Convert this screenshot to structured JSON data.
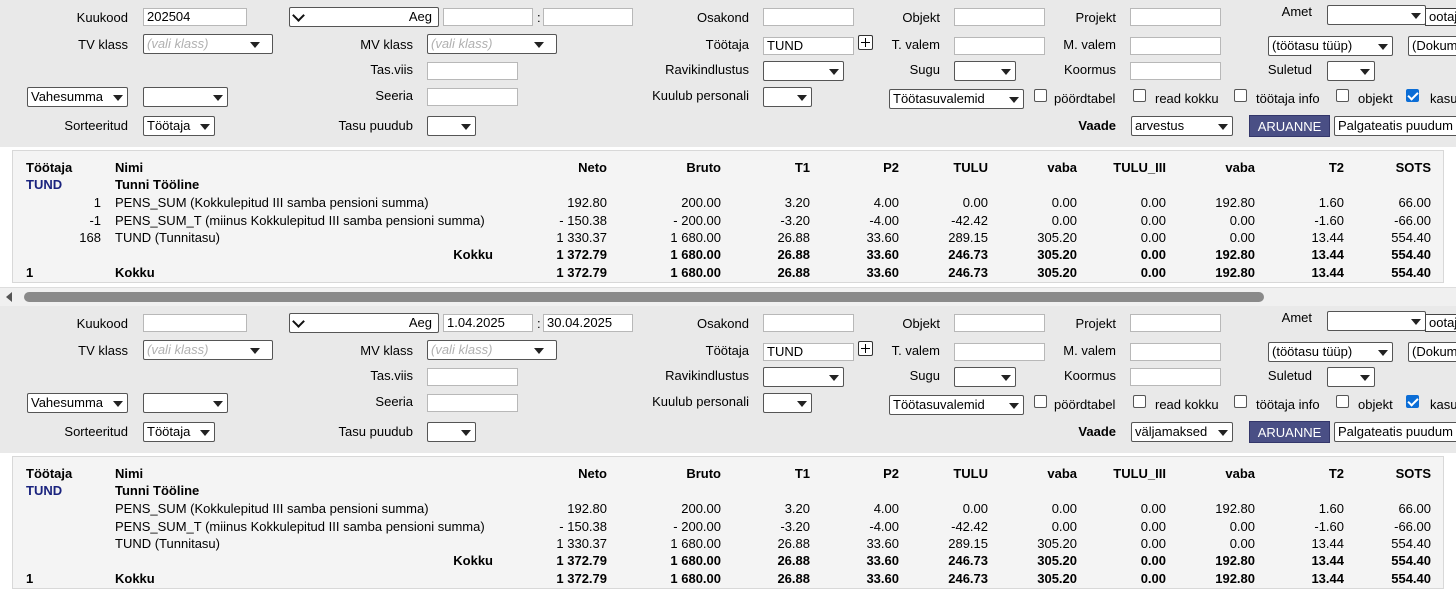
{
  "panels": [
    {
      "kuukood_label": "Kuukood",
      "kuukood_value": "202504",
      "aeg_select": "",
      "aeg_label": "Aeg",
      "aeg_from": "",
      "aeg_sep": ":",
      "aeg_to": "",
      "osakond_label": "Osakond",
      "objekt_label": "Objekt",
      "projekt_label": "Projekt",
      "amet_label": "Amet",
      "amet_select": "",
      "ootaja_value": "ootaja",
      "tvklass_label": "TV klass",
      "tvklass_ph": "(vali klass)",
      "mvklass_label": "MV klass",
      "mvklass_ph": "(vali klass)",
      "tootaja_label": "Töötaja",
      "tootaja_value": "TUND",
      "tvalem_label": "T. valem",
      "mvalem_label": "M. valem",
      "tootasu_tyyp": "(töötasu tüüp)",
      "dokum": "(Dokum",
      "tasviis_label": "Tas.viis",
      "ravikindlustus_label": "Ravikindlustus",
      "sugu_label": "Sugu",
      "koormus_label": "Koormus",
      "suletud_label": "Suletud",
      "vahesumma": "Vahesumma",
      "seeria_label": "Seeria",
      "kuulub_label": "Kuulub personali",
      "tootasuvalemid": "Töötasuvalemid",
      "poordtabel": "pöördtabel",
      "read_kokku": "read kokku",
      "tootaja_info": "töötaja info",
      "objekt_chk": "objekt",
      "kasu_chk": "kasu",
      "sorteeritud_label": "Sorteeritud",
      "sorteeritud_value": "Töötaja",
      "tasu_puudub_label": "Tasu puudub",
      "vaade_label": "Vaade",
      "vaade_value": "arvestus",
      "aruanne": "ARUANNE",
      "palgateatis": "Palgateatis puudum",
      "table": {
        "headers": [
          "Töötaja",
          "Nimi",
          "Neto",
          "Bruto",
          "T1",
          "P2",
          "TULU",
          "vaba",
          "TULU_III",
          "vaba",
          "T2",
          "SOTS"
        ],
        "group_code": "TUND",
        "group_name": "Tunni Tööline",
        "rows": [
          {
            "qty": "1",
            "name": "PENS_SUM (Kokkulepitud III samba pensioni summa)",
            "vals": [
              "192.80",
              "200.00",
              "3.20",
              "4.00",
              "0.00",
              "0.00",
              "0.00",
              "192.80",
              "1.60",
              "66.00"
            ]
          },
          {
            "qty": "-1",
            "name": "PENS_SUM_T (miinus Kokkulepitud III samba pensioni summa)",
            "vals": [
              "- 150.38",
              "- 200.00",
              "-3.20",
              "-4.00",
              "-42.42",
              "0.00",
              "0.00",
              "0.00",
              "-1.60",
              "-66.00"
            ]
          },
          {
            "qty": "168",
            "name": "TUND (Tunnitasu)",
            "vals": [
              "1 330.37",
              "1 680.00",
              "26.88",
              "33.60",
              "289.15",
              "305.20",
              "0.00",
              "0.00",
              "13.44",
              "554.40"
            ]
          }
        ],
        "kokku_label": "Kokku",
        "kokku_vals": [
          "1 372.79",
          "1 680.00",
          "26.88",
          "33.60",
          "246.73",
          "305.20",
          "0.00",
          "192.80",
          "13.44",
          "554.40"
        ],
        "total_qty": "1",
        "total_label": "Kokku",
        "total_vals": [
          "1 372.79",
          "1 680.00",
          "26.88",
          "33.60",
          "246.73",
          "305.20",
          "0.00",
          "192.80",
          "13.44",
          "554.40"
        ]
      }
    },
    {
      "kuukood_label": "Kuukood",
      "kuukood_value": "",
      "aeg_select": "",
      "aeg_label": "Aeg",
      "aeg_from": "1.04.2025",
      "aeg_sep": ":",
      "aeg_to": "30.04.2025",
      "osakond_label": "Osakond",
      "objekt_label": "Objekt",
      "projekt_label": "Projekt",
      "amet_label": "Amet",
      "amet_select": "",
      "ootaja_value": "ootaja",
      "tvklass_label": "TV klass",
      "tvklass_ph": "(vali klass)",
      "mvklass_label": "MV klass",
      "mvklass_ph": "(vali klass)",
      "tootaja_label": "Töötaja",
      "tootaja_value": "TUND",
      "tvalem_label": "T. valem",
      "mvalem_label": "M. valem",
      "tootasu_tyyp": "(töötasu tüüp)",
      "dokum": "(Dokum",
      "tasviis_label": "Tas.viis",
      "ravikindlustus_label": "Ravikindlustus",
      "sugu_label": "Sugu",
      "koormus_label": "Koormus",
      "suletud_label": "Suletud",
      "vahesumma": "Vahesumma",
      "seeria_label": "Seeria",
      "kuulub_label": "Kuulub personali",
      "tootasuvalemid": "Töötasuvalemid",
      "poordtabel": "pöördtabel",
      "read_kokku": "read kokku",
      "tootaja_info": "töötaja info",
      "objekt_chk": "objekt",
      "kasu_chk": "kasu",
      "sorteeritud_label": "Sorteeritud",
      "sorteeritud_value": "Töötaja",
      "tasu_puudub_label": "Tasu puudub",
      "vaade_label": "Vaade",
      "vaade_value": "väljamaksed",
      "aruanne": "ARUANNE",
      "palgateatis": "Palgateatis puudum",
      "table": {
        "headers": [
          "Töötaja",
          "Nimi",
          "Neto",
          "Bruto",
          "T1",
          "P2",
          "TULU",
          "vaba",
          "TULU_III",
          "vaba",
          "T2",
          "SOTS"
        ],
        "group_code": "TUND",
        "group_name": "Tunni Tööline",
        "rows": [
          {
            "qty": "",
            "name": "PENS_SUM (Kokkulepitud III samba pensioni summa)",
            "vals": [
              "192.80",
              "200.00",
              "3.20",
              "4.00",
              "0.00",
              "0.00",
              "0.00",
              "192.80",
              "1.60",
              "66.00"
            ]
          },
          {
            "qty": "",
            "name": "PENS_SUM_T (miinus Kokkulepitud III samba pensioni summa)",
            "vals": [
              "- 150.38",
              "- 200.00",
              "-3.20",
              "-4.00",
              "-42.42",
              "0.00",
              "0.00",
              "0.00",
              "-1.60",
              "-66.00"
            ]
          },
          {
            "qty": "",
            "name": "TUND (Tunnitasu)",
            "vals": [
              "1 330.37",
              "1 680.00",
              "26.88",
              "33.60",
              "289.15",
              "305.20",
              "0.00",
              "0.00",
              "13.44",
              "554.40"
            ]
          }
        ],
        "kokku_label": "Kokku",
        "kokku_vals": [
          "1 372.79",
          "1 680.00",
          "26.88",
          "33.60",
          "246.73",
          "305.20",
          "0.00",
          "192.80",
          "13.44",
          "554.40"
        ],
        "total_qty": "1",
        "total_label": "Kokku",
        "total_vals": [
          "1 372.79",
          "1 680.00",
          "26.88",
          "33.60",
          "246.73",
          "305.20",
          "0.00",
          "192.80",
          "13.44",
          "554.40"
        ]
      }
    }
  ]
}
